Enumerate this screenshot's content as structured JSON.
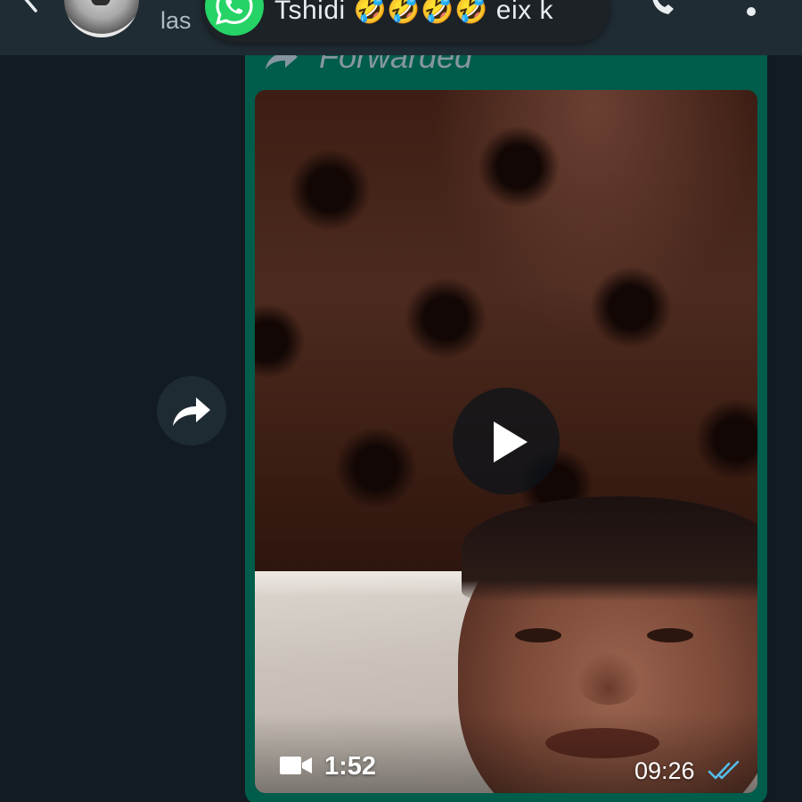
{
  "header": {
    "contact_name": "las",
    "back_icon": "back-arrow-icon",
    "call_icon": "phone-icon",
    "menu_icon": "more-options-icon"
  },
  "notification": {
    "app_icon": "whatsapp-icon",
    "text": "Tshidi 🤣🤣🤣🤣 eix k"
  },
  "message": {
    "forwarded_label": "Forwarded",
    "forwarded_icon": "forward-arrow-icon",
    "video": {
      "duration": "1:52",
      "timestamp": "09:26",
      "status": "read",
      "play_icon": "play-icon",
      "camera_icon": "video-camera-icon",
      "ticks_icon": "double-check-icon"
    }
  },
  "actions": {
    "share_icon": "share-forward-icon"
  },
  "colors": {
    "background": "#111b21",
    "header": "#202c33",
    "outgoing_bubble": "#005c4b",
    "read_ticks": "#53bdeb",
    "whatsapp_green": "#25d366"
  }
}
